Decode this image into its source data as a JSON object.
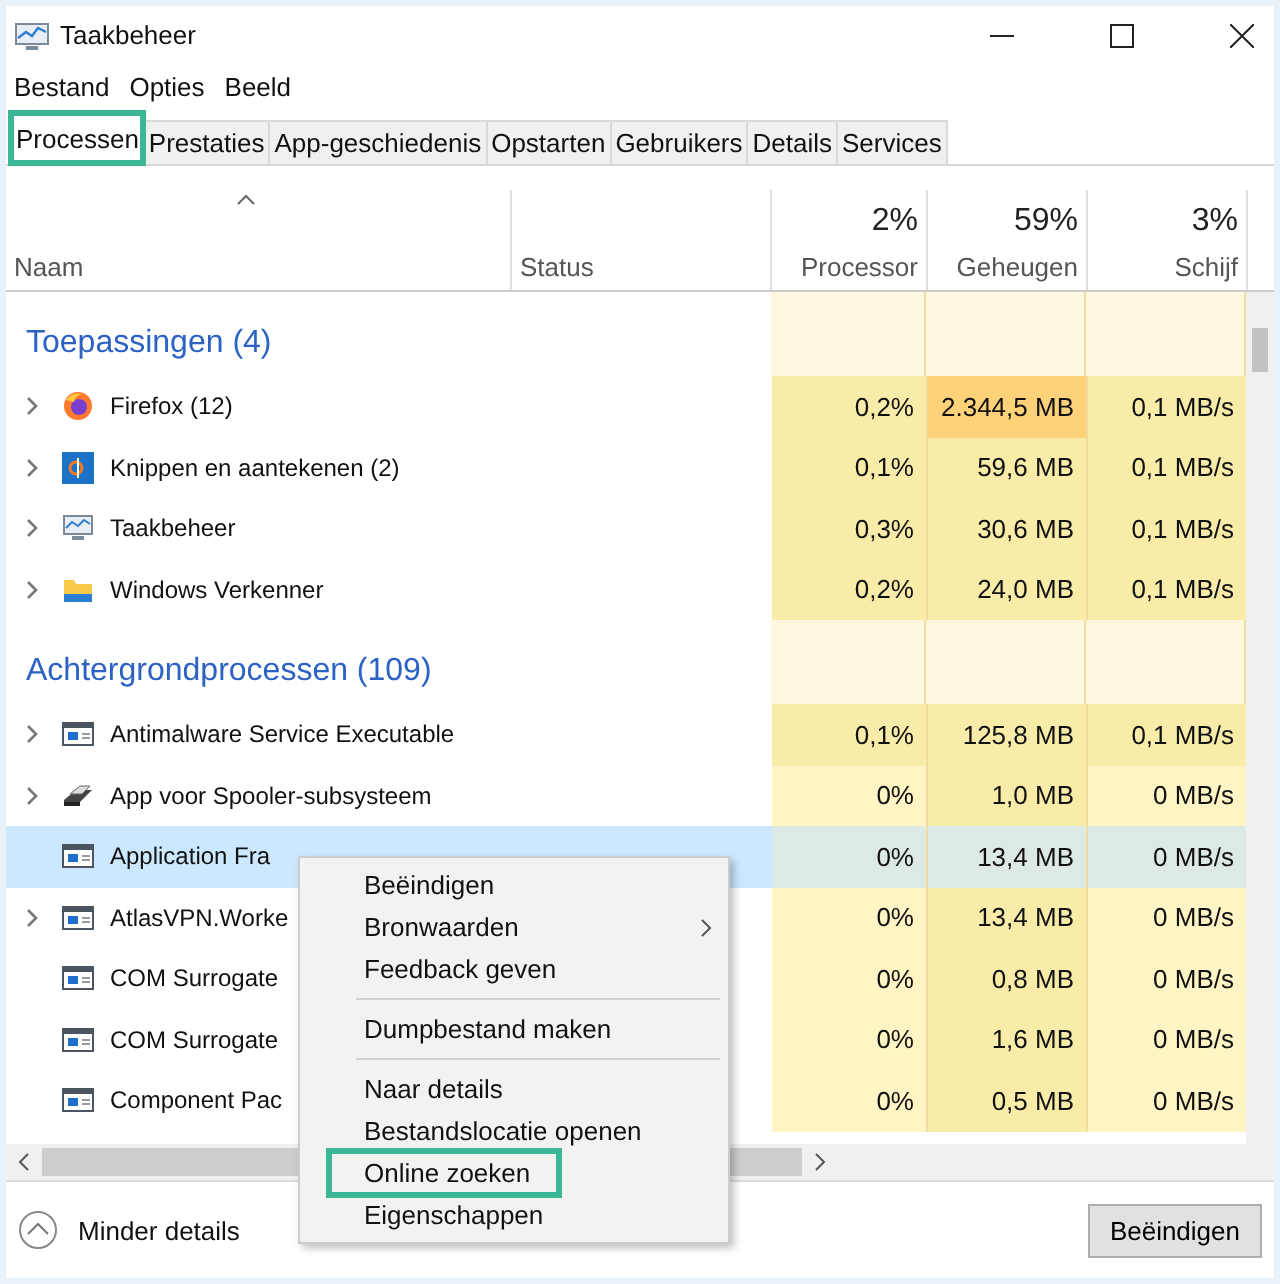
{
  "window": {
    "title": "Taakbeheer"
  },
  "menu": [
    "Bestand",
    "Opties",
    "Beeld"
  ],
  "tabs": [
    {
      "label": "Processen",
      "selected": true,
      "outlined": true
    },
    {
      "label": "Prestaties",
      "selected": false,
      "outlined": false
    },
    {
      "label": "App-geschiedenis",
      "selected": false,
      "outlined": false
    },
    {
      "label": "Opstarten",
      "selected": false,
      "outlined": false
    },
    {
      "label": "Gebruikers",
      "selected": false,
      "outlined": false
    },
    {
      "label": "Details",
      "selected": false,
      "outlined": false
    },
    {
      "label": "Services",
      "selected": false,
      "outlined": false
    }
  ],
  "columns": [
    {
      "label": "Naam",
      "sorted": true
    },
    {
      "label": "Status",
      "sorted": false
    },
    {
      "label": "Processor",
      "usage": "2%",
      "sorted": false
    },
    {
      "label": "Geheugen",
      "usage": "59%",
      "sorted": false
    },
    {
      "label": "Schijf",
      "usage": "3%",
      "sorted": false
    }
  ],
  "groups": [
    {
      "title": "Toepassingen (4)",
      "rows": [
        {
          "name": "Firefox (12)",
          "kind": "firefox",
          "expandable": true,
          "selected": false,
          "cells": [
            {
              "text": "0,2%",
              "color": "#f9eca8"
            },
            {
              "text": "2.344,5 MB",
              "color": "#ffd27a"
            },
            {
              "text": "0,1 MB/s",
              "color": "#f9eca8"
            }
          ]
        },
        {
          "name": "Knippen en aantekenen (2)",
          "kind": "snip",
          "expandable": true,
          "selected": false,
          "cells": [
            {
              "text": "0,1%",
              "color": "#f9eca8"
            },
            {
              "text": "59,6 MB",
              "color": "#f9eca8"
            },
            {
              "text": "0,1 MB/s",
              "color": "#f9eca8"
            }
          ]
        },
        {
          "name": "Taakbeheer",
          "kind": "monitor",
          "expandable": true,
          "selected": false,
          "cells": [
            {
              "text": "0,3%",
              "color": "#f9eca8"
            },
            {
              "text": "30,6 MB",
              "color": "#f9eca8"
            },
            {
              "text": "0,1 MB/s",
              "color": "#f9eca8"
            }
          ]
        },
        {
          "name": "Windows Verkenner",
          "kind": "folder",
          "expandable": true,
          "selected": false,
          "cells": [
            {
              "text": "0,2%",
              "color": "#f9eca8"
            },
            {
              "text": "24,0 MB",
              "color": "#f9eca8"
            },
            {
              "text": "0,1 MB/s",
              "color": "#f9eca8"
            }
          ]
        }
      ]
    },
    {
      "title": "Achtergrondprocessen (109)",
      "rows": [
        {
          "name": "Antimalware Service Executable",
          "kind": "window",
          "expandable": true,
          "selected": false,
          "cells": [
            {
              "text": "0,1%",
              "color": "#f9eca8"
            },
            {
              "text": "125,8 MB",
              "color": "#f9eca8"
            },
            {
              "text": "0,1 MB/s",
              "color": "#f9eca8"
            }
          ]
        },
        {
          "name": "App voor Spooler-subsysteem",
          "kind": "printer",
          "expandable": true,
          "selected": false,
          "cells": [
            {
              "text": "0%",
              "color": "#fff4c4"
            },
            {
              "text": "1,0 MB",
              "color": "#f9eca8"
            },
            {
              "text": "0 MB/s",
              "color": "#fff4c4"
            }
          ]
        },
        {
          "name": "Application Fra",
          "kind": "window",
          "expandable": false,
          "selected": true,
          "cells": [
            {
              "text": "0%",
              "color": "#dde9e4"
            },
            {
              "text": "13,4 MB",
              "color": "#dde9e4"
            },
            {
              "text": "0 MB/s",
              "color": "#dde9e4"
            }
          ]
        },
        {
          "name": "AtlasVPN.Worke",
          "kind": "window",
          "expandable": true,
          "selected": false,
          "cells": [
            {
              "text": "0%",
              "color": "#fff4c4"
            },
            {
              "text": "13,4 MB",
              "color": "#f9eca8"
            },
            {
              "text": "0 MB/s",
              "color": "#fff4c4"
            }
          ]
        },
        {
          "name": "COM Surrogate",
          "kind": "window",
          "expandable": false,
          "selected": false,
          "cells": [
            {
              "text": "0%",
              "color": "#fff4c4"
            },
            {
              "text": "0,8 MB",
              "color": "#f9eca8"
            },
            {
              "text": "0 MB/s",
              "color": "#fff4c4"
            }
          ]
        },
        {
          "name": "COM Surrogate",
          "kind": "window",
          "expandable": false,
          "selected": false,
          "cells": [
            {
              "text": "0%",
              "color": "#fff4c4"
            },
            {
              "text": "1,6 MB",
              "color": "#f9eca8"
            },
            {
              "text": "0 MB/s",
              "color": "#fff4c4"
            }
          ]
        },
        {
          "name": "Component Pac",
          "kind": "window",
          "expandable": false,
          "selected": false,
          "cells": [
            {
              "text": "0%",
              "color": "#fff4c4"
            },
            {
              "text": "0,5 MB",
              "color": "#f9eca8"
            },
            {
              "text": "0 MB/s",
              "color": "#fff4c4"
            }
          ]
        }
      ]
    }
  ],
  "context_menu": [
    {
      "kind": "item",
      "label": "Beëindigen",
      "submenu": false,
      "outlined": false
    },
    {
      "kind": "item",
      "label": "Bronwaarden",
      "submenu": true,
      "outlined": false
    },
    {
      "kind": "item",
      "label": "Feedback geven",
      "submenu": false,
      "outlined": false
    },
    {
      "kind": "separator"
    },
    {
      "kind": "item",
      "label": "Dumpbestand maken",
      "submenu": false,
      "outlined": false
    },
    {
      "kind": "separator"
    },
    {
      "kind": "item",
      "label": "Naar details",
      "submenu": false,
      "outlined": false
    },
    {
      "kind": "item",
      "label": "Bestandslocatie openen",
      "submenu": false,
      "outlined": false
    },
    {
      "kind": "item",
      "label": "Online zoeken",
      "submenu": false,
      "outlined": true
    },
    {
      "kind": "item",
      "label": "Eigenschappen",
      "submenu": false,
      "outlined": false
    }
  ],
  "footer": {
    "toggle": "Minder details",
    "button": "Beëindigen"
  }
}
